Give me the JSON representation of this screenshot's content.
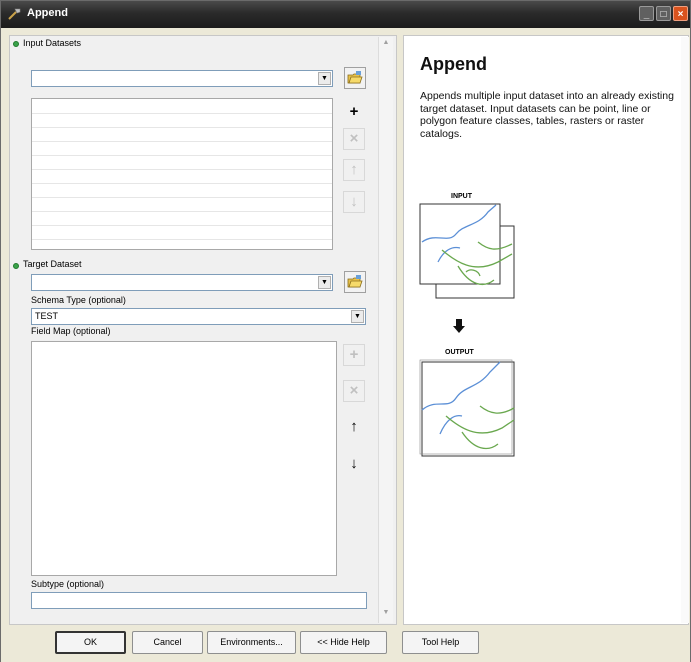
{
  "window": {
    "title": "Append"
  },
  "form": {
    "input_datasets_label": "Input Datasets",
    "input_datasets_value": "",
    "target_dataset_label": "Target Dataset",
    "target_dataset_value": "",
    "schema_type_label": "Schema Type (optional)",
    "schema_type_value": "TEST",
    "field_map_label": "Field Map (optional)",
    "subtype_label": "Subtype (optional)",
    "subtype_value": ""
  },
  "side_buttons": {
    "add": "+",
    "remove": "×",
    "up": "↑",
    "down": "↓"
  },
  "help": {
    "title": "Append",
    "description": "Appends multiple input dataset into an already existing target dataset. Input datasets can be point, line or polygon feature classes, tables, rasters or raster catalogs.",
    "input_label": "INPUT",
    "output_label": "OUTPUT"
  },
  "buttons": {
    "ok": "OK",
    "cancel": "Cancel",
    "environments": "Environments...",
    "hide_help": "<< Hide Help",
    "tool_help": "Tool Help"
  },
  "colors": {
    "river_blue": "#5b8fd6",
    "river_green": "#6aa84f",
    "required_dot": "#3aa24a"
  }
}
